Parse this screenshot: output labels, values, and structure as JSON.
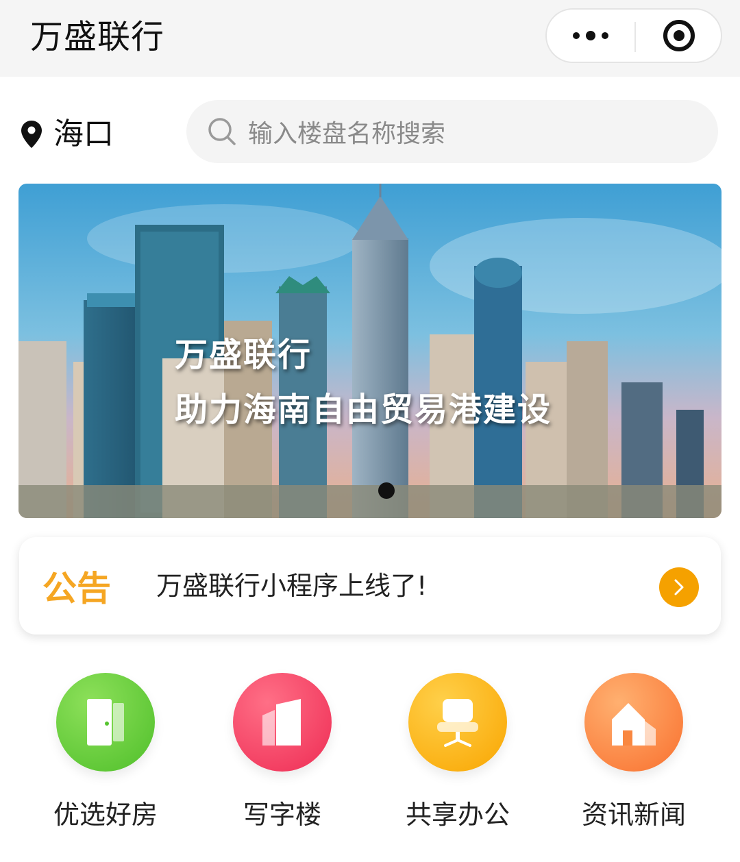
{
  "header": {
    "title": "万盛联行",
    "more_icon": "more-dots-icon",
    "close_icon": "close-target-icon"
  },
  "location": {
    "city": "海口",
    "icon": "location-pin-icon"
  },
  "search": {
    "placeholder": "输入楼盘名称搜索",
    "icon": "search-icon"
  },
  "banner": {
    "line1": "万盛联行",
    "line2": "助力海南自由贸易港建设",
    "slides": 1,
    "active_slide": 1
  },
  "notice": {
    "badge": "公告",
    "text": "万盛联行小程序上线了!",
    "arrow_icon": "chevron-right-icon",
    "accent": "#f5a100"
  },
  "nav": [
    {
      "label": "优选好房",
      "icon": "door-icon",
      "color": "#5cc935"
    },
    {
      "label": "写字楼",
      "icon": "office-building-icon",
      "color": "#f2385c"
    },
    {
      "label": "共享办公",
      "icon": "office-chair-icon",
      "color": "#fbb216"
    },
    {
      "label": "资讯新闻",
      "icon": "house-icon",
      "color": "#f9803a"
    }
  ]
}
